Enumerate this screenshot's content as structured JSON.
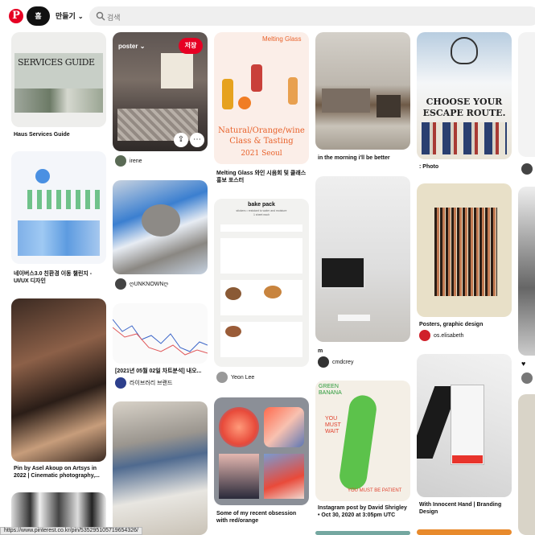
{
  "header": {
    "logo": "P",
    "home": "홈",
    "create": "만들기",
    "search_placeholder": "검색"
  },
  "pins": {
    "haus": {
      "title_art": "SERVICES GUIDE",
      "caption": "Haus Services Guide"
    },
    "naver": {
      "caption": "네이버스3.0 친환경 이동 챌린지 - UI/UX 디자인"
    },
    "asel": {
      "caption": "Pin by Asel Akoup on Artsys in 2022 | Cinematic photography,..."
    },
    "poster": {
      "board_label": "poster",
      "save_label": "저장",
      "user": "irene"
    },
    "cat": {
      "user": "ღUNKNOWNღ"
    },
    "chart": {
      "caption": "[2021년 05월 02일 차트분석] 내오...",
      "user": "라이브러리 브랜드"
    },
    "melting": {
      "heading": "Melting Glass",
      "art_line1": "Natural/Orange/wine",
      "art_line2": "Class & Tasting",
      "art_line3": "2021 Seoul",
      "caption": "Melting Glass 와인 시음회 및 클래스 홍보 포스터"
    },
    "bakepack": {
      "title": "bake pack",
      "subtitle": "stickers • resistant to water and moisture",
      "size": "1 sheet each",
      "user": "Yeon Lee"
    },
    "gradient": {
      "caption": "Some of my recent obsession with red/orange"
    },
    "room": {
      "caption": "in the morning i'll be better"
    },
    "desk": {
      "caption": "m",
      "user": "cmdcrey"
    },
    "banana": {
      "top_text": "GREEN BANANA",
      "mid_text": "YOU MUST WAIT",
      "bottom_text": "YOU MUST BE PATIENT",
      "caption": "Instagram post by David Shrigley • Oct 30, 2020 at 3:05pm UTC"
    },
    "escape": {
      "art_line1": "CHOOSE YOUR",
      "art_line2": "ESCAPE ROUTE.",
      "caption": "Photo"
    },
    "elisabeth": {
      "caption": "Posters, graphic design",
      "user": "os.elisabeth"
    },
    "innocent": {
      "caption": "With Innocent Hand | Branding Design"
    }
  },
  "status_url": "https://www.pinterest.co.kr/pin/535295105719654326/",
  "colors": {
    "brand": "#e60023",
    "text": "#111111",
    "search_bg": "#efefef"
  }
}
